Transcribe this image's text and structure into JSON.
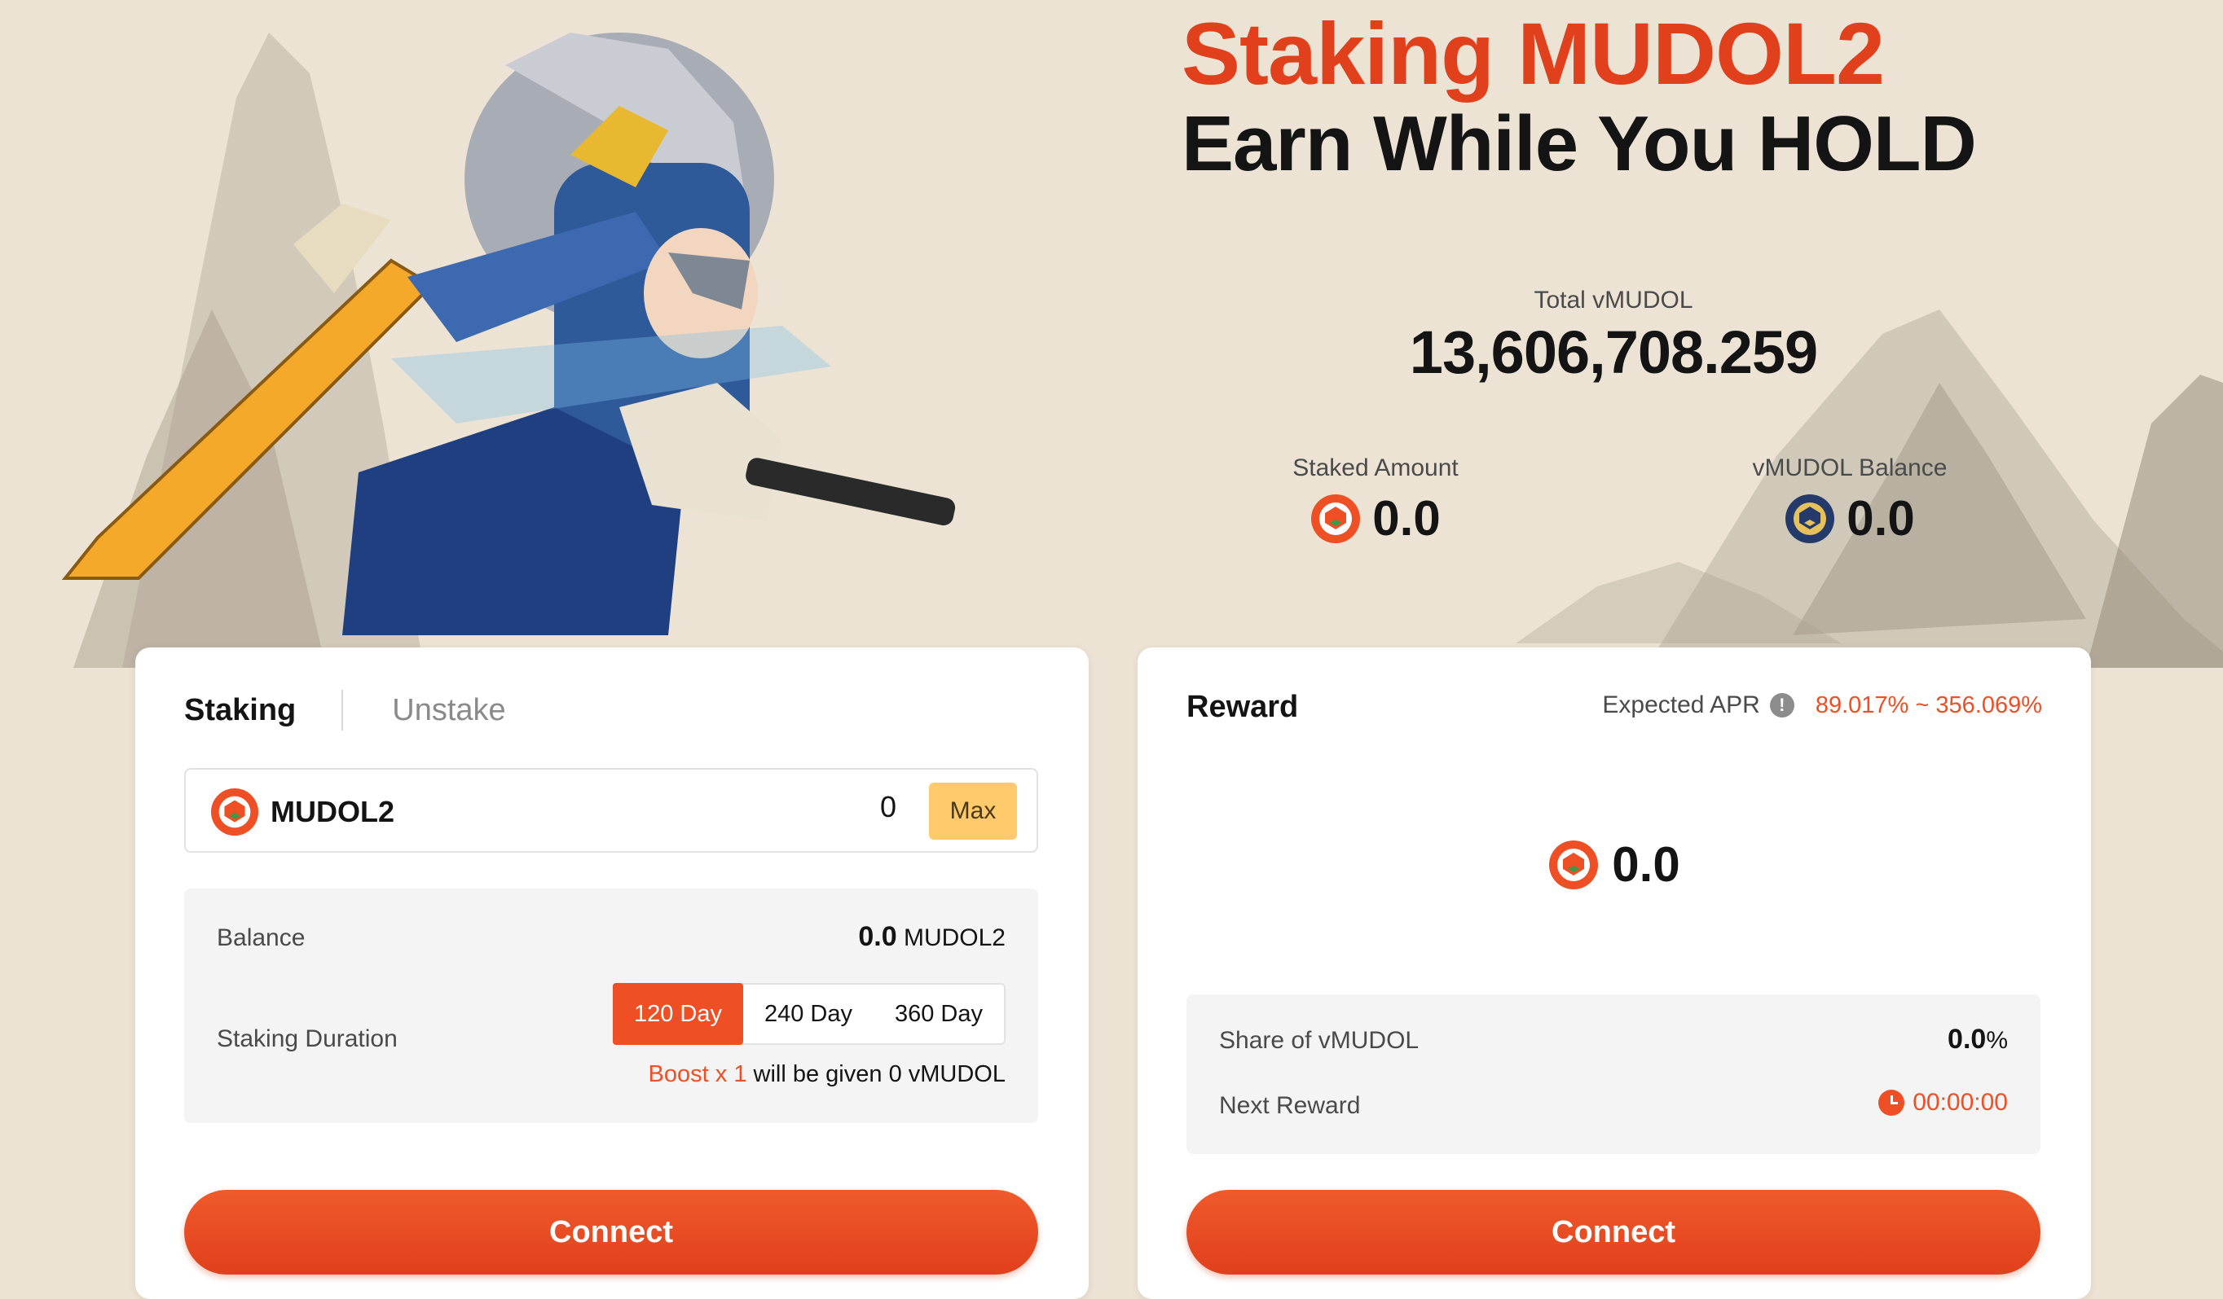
{
  "hero": {
    "title_line1": "Staking MUDOL2",
    "title_line2": "Earn While You HOLD"
  },
  "totals": {
    "total_label": "Total vMUDOL",
    "total_value": "13,606,708.259",
    "staked_label": "Staked Amount",
    "staked_value": "0.0",
    "vbalance_label": "vMUDOL Balance",
    "vbalance_value": "0.0"
  },
  "staking_card": {
    "tabs": [
      {
        "label": "Staking",
        "active": true
      },
      {
        "label": "Unstake",
        "active": false
      }
    ],
    "token_name": "MUDOL2",
    "amount_value": "0",
    "max_label": "Max",
    "balance_label": "Balance",
    "balance_value": "0.0",
    "balance_unit": "MUDOL2",
    "duration_label": "Staking Duration",
    "durations": [
      {
        "label": "120 Day",
        "selected": true
      },
      {
        "label": "240 Day",
        "selected": false
      },
      {
        "label": "360 Day",
        "selected": false
      }
    ],
    "boost_highlight": "Boost x 1",
    "boost_text": "will be given",
    "boost_amount": "0",
    "boost_unit": "vMUDOL",
    "connect_label": "Connect"
  },
  "reward_card": {
    "title": "Reward",
    "apr_label": "Expected APR",
    "apr_info_glyph": "!",
    "apr_value": "89.017% ~ 356.069%",
    "reward_value": "0.0",
    "share_label": "Share of vMUDOL",
    "share_value": "0.0",
    "share_unit": "%",
    "next_label": "Next Reward",
    "next_value": "00:00:00",
    "connect_label": "Connect"
  },
  "colors": {
    "accent": "#ee4f25",
    "title_red": "#e0401c",
    "max_button": "#ffca6b",
    "background": "#ece3d4"
  },
  "icons": {
    "mudol_coin": "mudol-coin-icon",
    "vmudol_coin": "vmudol-coin-icon",
    "info": "info-icon",
    "clock": "clock-icon"
  }
}
